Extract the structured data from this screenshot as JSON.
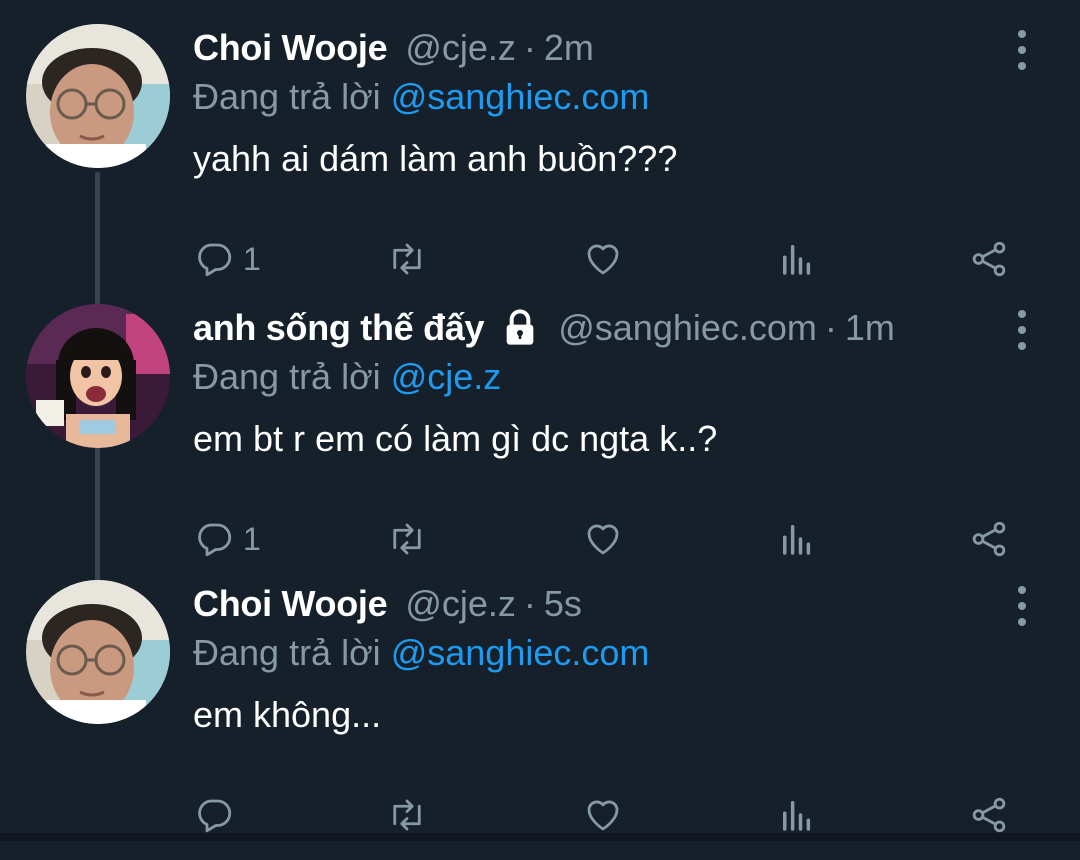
{
  "thread": {
    "tweets": [
      {
        "name": "Choi Wooje",
        "handle": "@cje.z",
        "separator": "·",
        "time": "2m",
        "reply_prefix": "Đang trả lời",
        "reply_to": "@sanghiec.com",
        "text": "yahh ai dám làm anh buồn???",
        "reply_count": "1",
        "locked": false,
        "avatar": "avatar-photo-boy-glasses"
      },
      {
        "name": "anh sống thế đấy",
        "handle": "@sanghiec.com",
        "separator": "·",
        "time": "1m",
        "reply_prefix": "Đang trả lời",
        "reply_to": "@cje.z",
        "text": "em bt r em có làm gì dc ngta k..?",
        "reply_count": "1",
        "locked": true,
        "avatar": "avatar-cartoon-doll"
      },
      {
        "name": "Choi Wooje",
        "handle": "@cje.z",
        "separator": "·",
        "time": "5s",
        "reply_prefix": "Đang trả lời",
        "reply_to": "@sanghiec.com",
        "text": "em không...",
        "reply_count": "",
        "locked": false,
        "avatar": "avatar-photo-boy-glasses"
      }
    ]
  },
  "icons": {
    "reply": "reply-icon",
    "retweet": "retweet-icon",
    "like": "heart-icon",
    "analytics": "analytics-icon",
    "share": "share-icon",
    "more": "more-options-icon",
    "lock": "lock-icon"
  },
  "colors": {
    "background": "#15202b",
    "text_primary": "#ffffff",
    "text_secondary": "#8899a6",
    "mention": "#1d9bf0",
    "thread_line": "#38444d"
  }
}
